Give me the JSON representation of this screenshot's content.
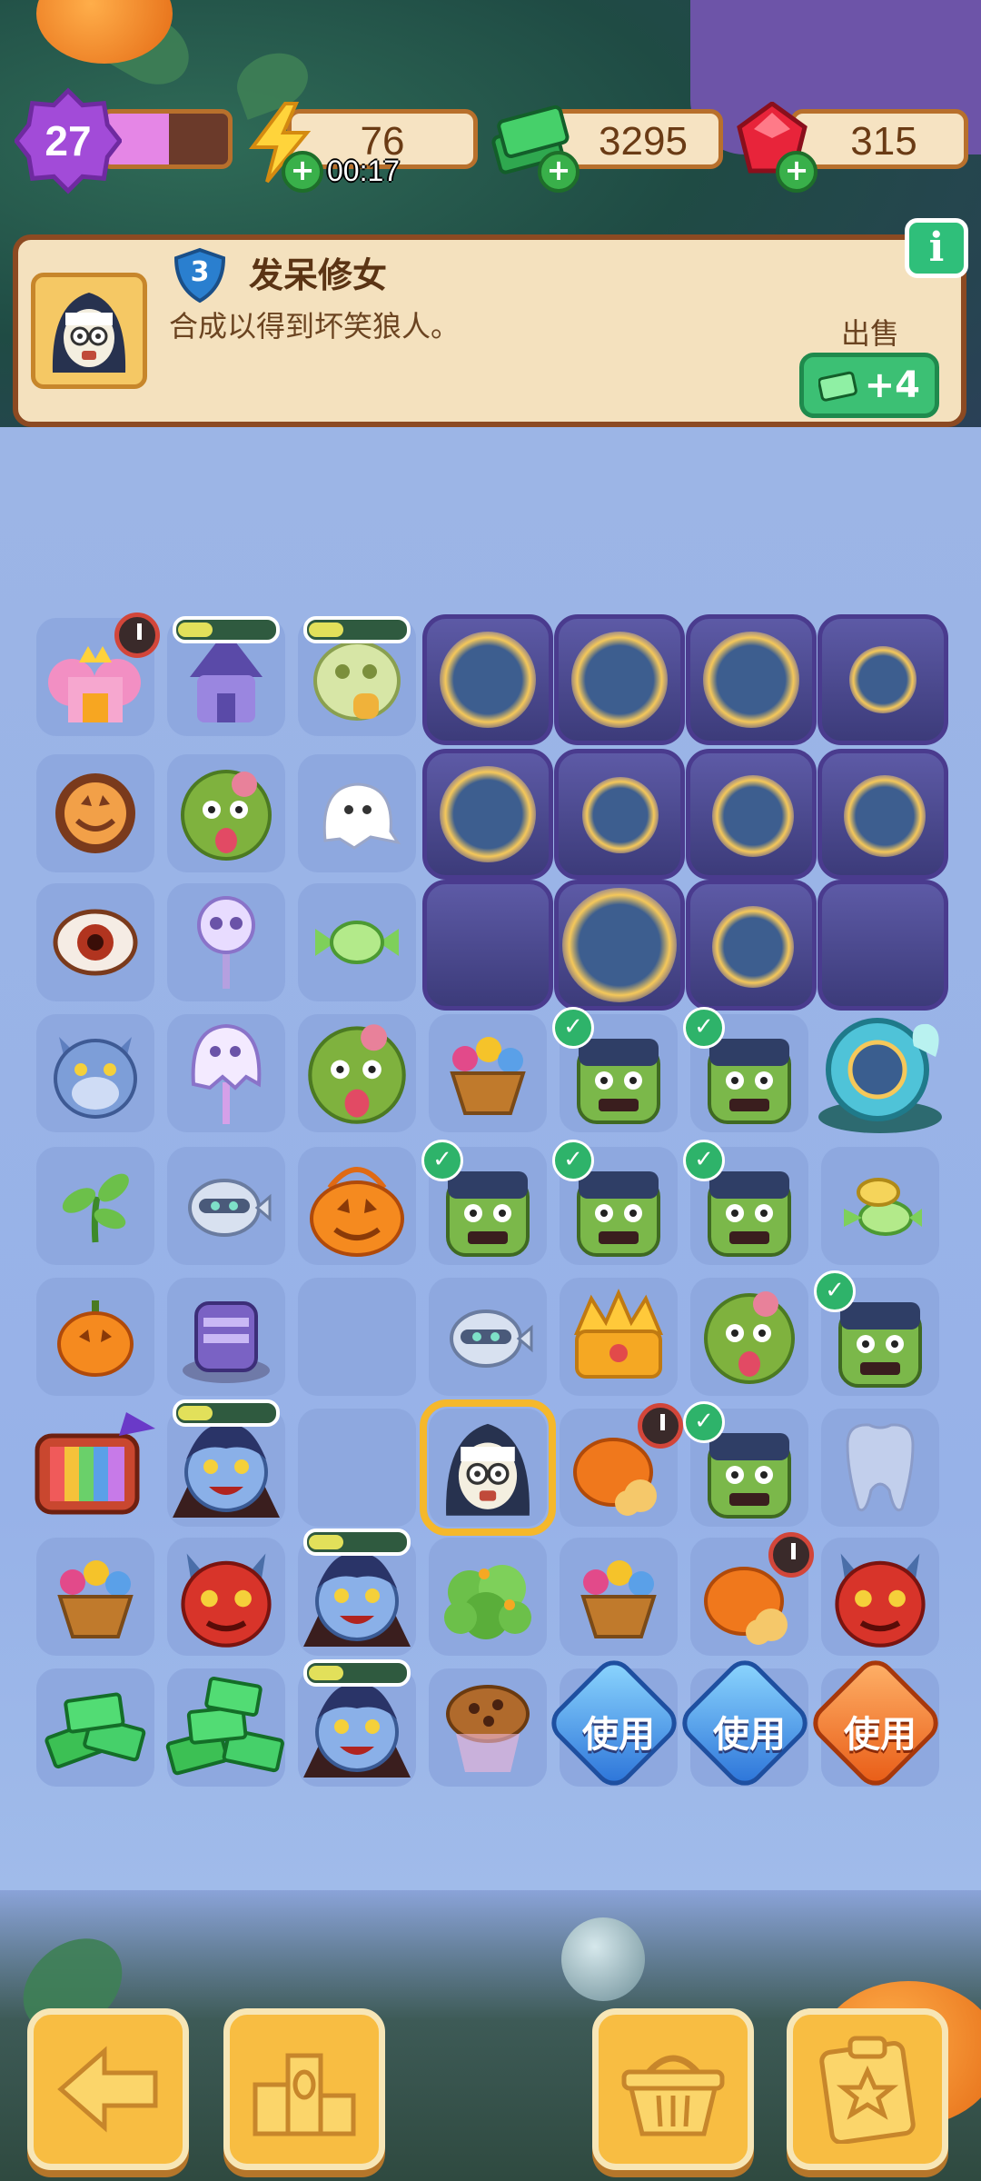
{
  "hud": {
    "level": "27",
    "xp_fraction": 0.52,
    "energy": "76",
    "energy_timer": "00:17",
    "cash": "3295",
    "gems": "315"
  },
  "panel": {
    "item_level": "3",
    "item_name": "发呆修女",
    "item_desc": "合成以得到坏笑狼人。",
    "sell_label": "出售",
    "sell_value": "+4",
    "info_icon": "i"
  },
  "board": {
    "use_label": "使用",
    "check_mark": "✓"
  },
  "colors": {
    "accent": "#f8bd42",
    "panel_bg": "#f4e1be",
    "board_bg": "#9bb6e8",
    "sell_green": "#3cc074"
  }
}
